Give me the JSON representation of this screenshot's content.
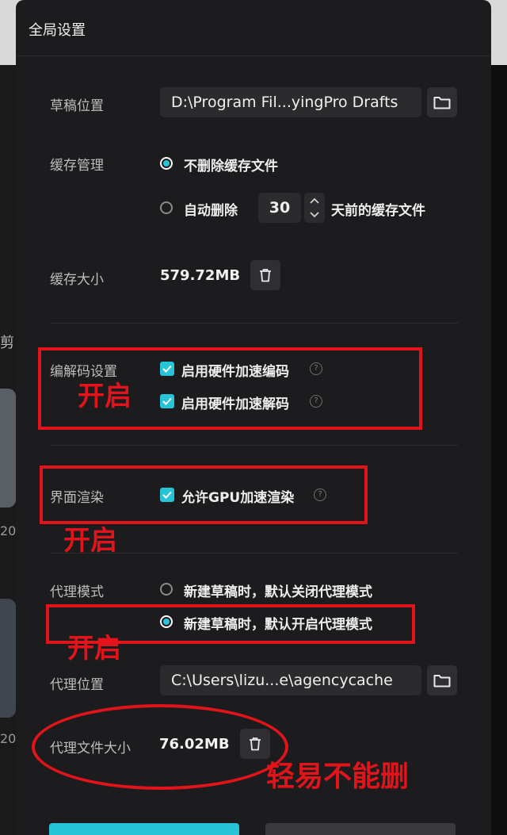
{
  "dialog": {
    "title": "全局设置"
  },
  "draft_location": {
    "label": "草稿位置",
    "path": "D:\\Program Fil...yingPro Drafts",
    "browse_icon": "folder-icon"
  },
  "cache_management": {
    "label": "缓存管理",
    "option_keep": "不删除缓存文件",
    "option_auto_prefix": "自动删除",
    "auto_days": "30",
    "option_auto_suffix": "天前的缓存文件",
    "selected": "option_keep"
  },
  "cache_size": {
    "label": "缓存大小",
    "value": "579.72MB",
    "clear_icon": "trash-icon"
  },
  "codec": {
    "label": "编解码设置",
    "hw_encode": "启用硬件加速编码",
    "hw_decode": "启用硬件加速解码",
    "hw_encode_checked": true,
    "hw_decode_checked": true
  },
  "render": {
    "label": "界面渲染",
    "gpu": "允许GPU加速渲染",
    "gpu_checked": true
  },
  "proxy_mode": {
    "label": "代理模式",
    "option_off": "新建草稿时，默认关闭代理模式",
    "option_on": "新建草稿时，默认开启代理模式",
    "selected": "option_on"
  },
  "proxy_location": {
    "label": "代理位置",
    "path": "C:\\Users\\lizu...e\\agencycache",
    "browse_icon": "folder-icon"
  },
  "proxy_size": {
    "label": "代理文件大小",
    "value": "76.02MB",
    "clear_icon": "trash-icon"
  },
  "annotations": {
    "codec_note": "开启",
    "render_note": "开启",
    "proxy_note": "开启",
    "proxy_size_note": "轻易不能删"
  },
  "background": {
    "glyph_1": "剪",
    "glyph_2": "20",
    "glyph_3": "20"
  },
  "colors": {
    "accent": "#27c3d6",
    "annotation": "#e0141a",
    "dialog_bg": "#1c1c1e"
  }
}
